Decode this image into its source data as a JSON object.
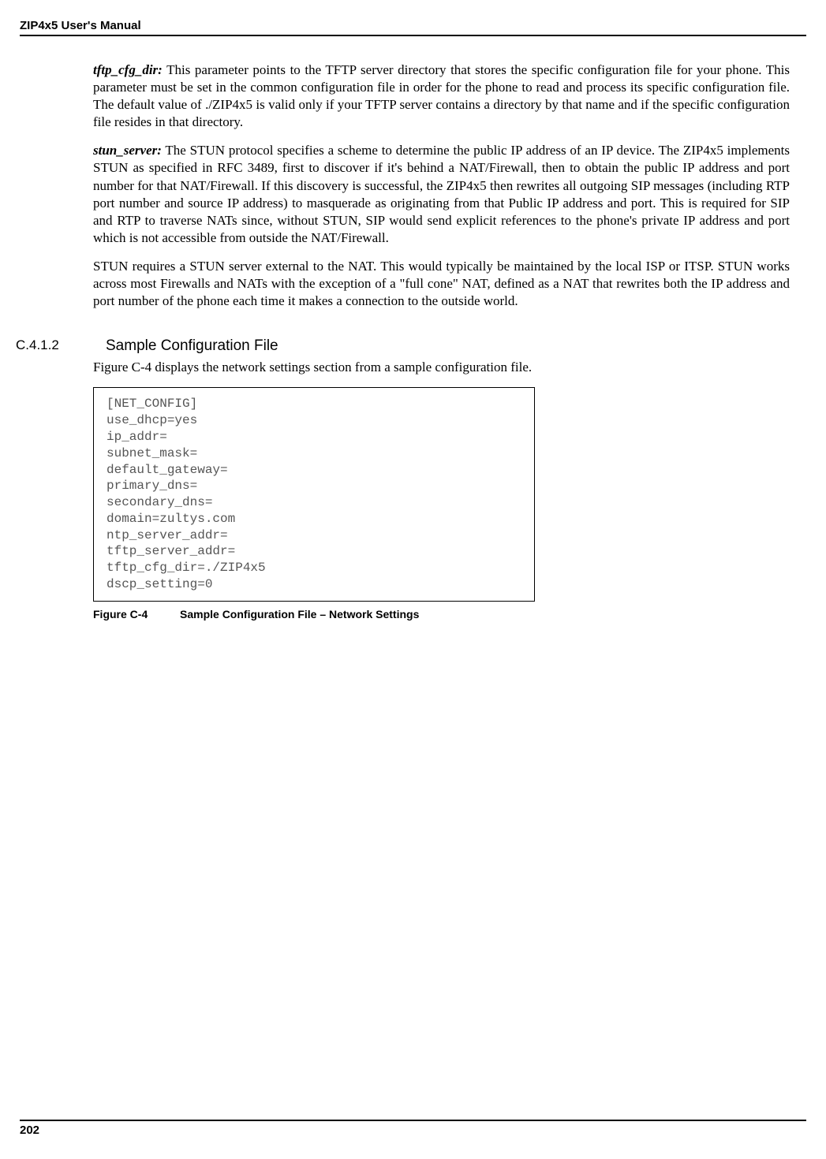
{
  "header": {
    "title": "ZIP4x5 User's Manual"
  },
  "paragraphs": {
    "p1_label": "tftp_cfg_dir:",
    "p1_text": " This parameter points to the TFTP server directory that stores the specific configuration file for your phone. This parameter must be set in the common configuration file in order for the phone to read and process its specific configuration file. The default value of ./ZIP4x5 is valid only if your TFTP server contains a directory by that name and if the specific configuration file resides in that directory.",
    "p2_label": "stun_server:",
    "p2_text": " The STUN protocol specifies a scheme to determine the public IP address of an IP device. The ZIP4x5 implements STUN as specified in RFC 3489, first to discover if it's behind a NAT/Firewall, then to obtain the public IP address and port number for that NAT/Firewall. If this discovery is successful, the ZIP4x5 then rewrites all outgoing SIP messages (including RTP port number and source IP address) to masquerade as originating from that Public IP address and port. This is required for SIP and RTP to traverse NATs since, without STUN, SIP would send explicit references to the phone's private IP address and port which is not accessible from outside the NAT/Firewall.",
    "p3_text": "STUN requires a STUN server external to the NAT. This would typically be maintained by the local ISP or ITSP. STUN works across most Firewalls and NATs with the exception of a \"full cone\" NAT, defined as a NAT that rewrites both the IP address and port number of the phone each time it makes a connection to the outside world."
  },
  "section": {
    "number": "C.4.1.2",
    "title": "Sample Configuration File",
    "intro": "Figure C-4 displays the network settings section from a sample configuration file."
  },
  "code": {
    "l1": "[NET_CONFIG]",
    "l2": "use_dhcp=yes",
    "l3": "ip_addr=",
    "l4": "subnet_mask=",
    "l5": "default_gateway=",
    "l6": "primary_dns=",
    "l7": "secondary_dns=",
    "l8": "domain=zultys.com",
    "l9": "ntp_server_addr=",
    "l10": "tftp_server_addr=",
    "l11": "tftp_cfg_dir=./ZIP4x5",
    "l12": "dscp_setting=0"
  },
  "figure": {
    "num": "Figure C-4",
    "caption": "Sample Configuration File – Network Settings"
  },
  "footer": {
    "page": "202"
  }
}
